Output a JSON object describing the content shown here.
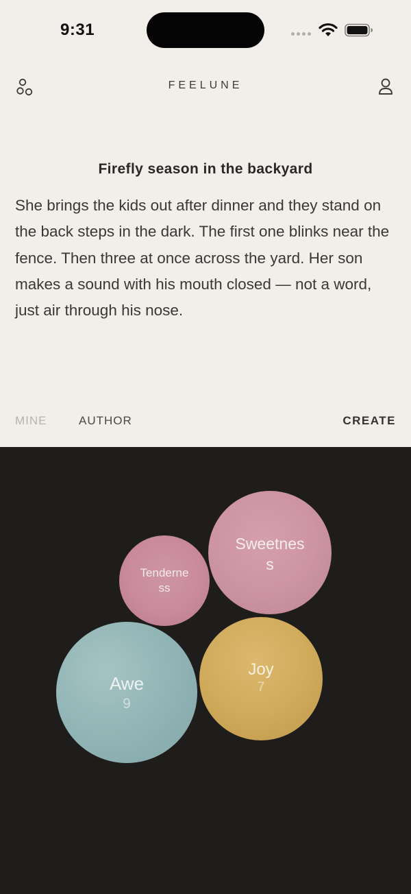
{
  "status": {
    "time": "9:31"
  },
  "header": {
    "brand": "FEELUNE",
    "left_icon": "circles-icon",
    "right_icon": "profile-icon"
  },
  "story": {
    "title": "Firefly season in the backyard",
    "body": "She brings the kids out after dinner and they stand on the back steps in the dark. The first one blinks near the fence. Then three at once across the yard. Her son makes a sound with his mouth closed — not a word, just air through his nose."
  },
  "tabs": {
    "mine": "MINE",
    "author": "AUTHOR",
    "create": "CREATE"
  },
  "emotions": [
    {
      "label": "Tenderness",
      "display_lines": [
        "Tenderne",
        "ss"
      ],
      "count": "",
      "color": "#c98a9d"
    },
    {
      "label": "Sweetness",
      "display_lines": [
        "Sweetnes",
        "s"
      ],
      "count": "",
      "color": "#cd94a4"
    },
    {
      "label": "Awe",
      "display_lines": [
        "Awe"
      ],
      "count": "9",
      "color": "#8fb3b4"
    },
    {
      "label": "Joy",
      "display_lines": [
        "Joy"
      ],
      "count": "7",
      "color": "#d1ab5c"
    }
  ],
  "colors": {
    "background": "#f2efea",
    "dark_panel": "#1f1d1b",
    "text_primary": "#2a2826",
    "tab_inactive": "#b6b2ac"
  }
}
